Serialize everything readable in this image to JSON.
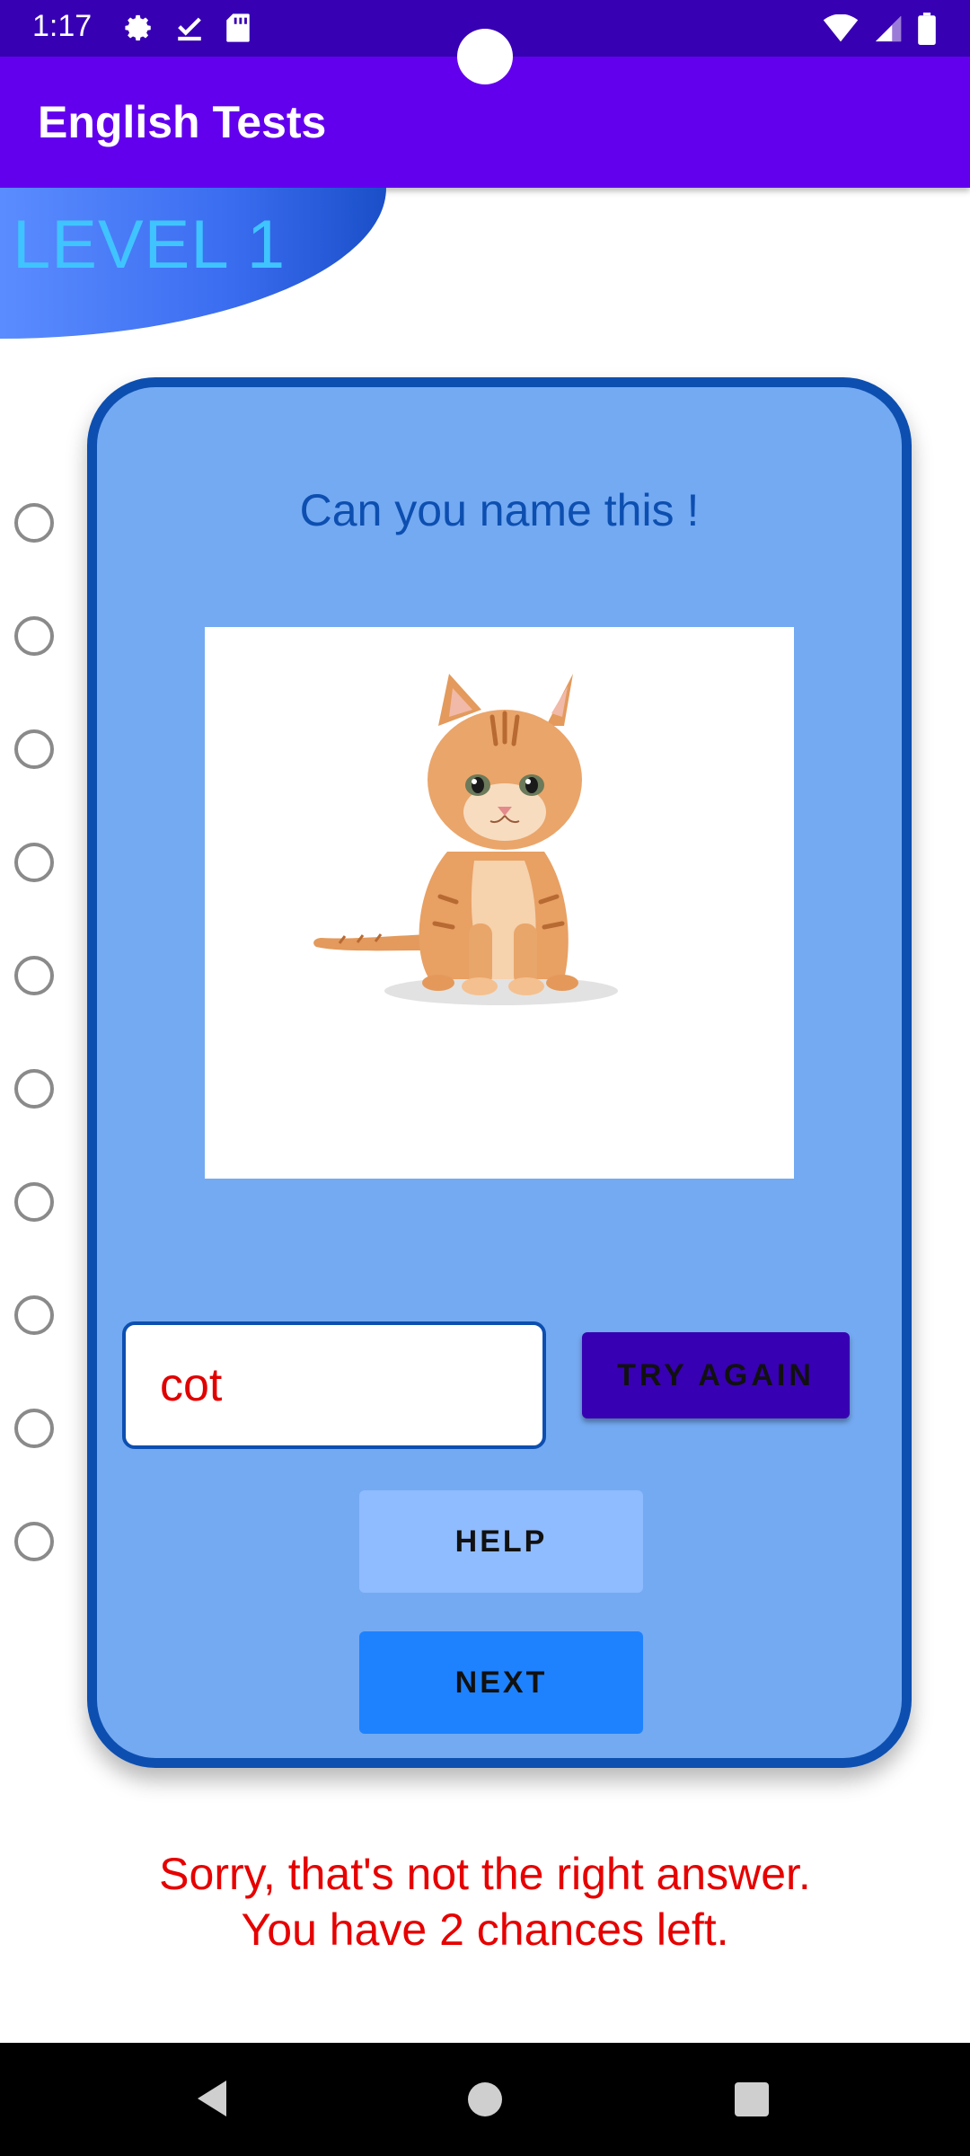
{
  "status_bar": {
    "time": "1:17",
    "left_icons": [
      "gear-icon",
      "download-check-icon",
      "sd-card-icon"
    ],
    "right_icons": [
      "wifi-icon",
      "signal-icon",
      "battery-icon"
    ]
  },
  "app_bar": {
    "title": "English Tests"
  },
  "level": {
    "label": "LEVEL 1"
  },
  "progress": {
    "total_steps": 10,
    "filled_steps": 0
  },
  "card": {
    "question": "Can you name this !",
    "image": "kitten-image",
    "answer_value": "cot",
    "try_again_label": "TRY AGAIN",
    "help_label": "HELP",
    "next_label": "NEXT"
  },
  "message": {
    "line1": "Sorry, that's not the right answer.",
    "line2": "You have 2 chances left."
  },
  "colors": {
    "status_bar": "#3700b3",
    "app_bar": "#6200ee",
    "card_fill": "#74aaf2",
    "card_border": "#0d4fb0",
    "error_text": "#e60000"
  }
}
